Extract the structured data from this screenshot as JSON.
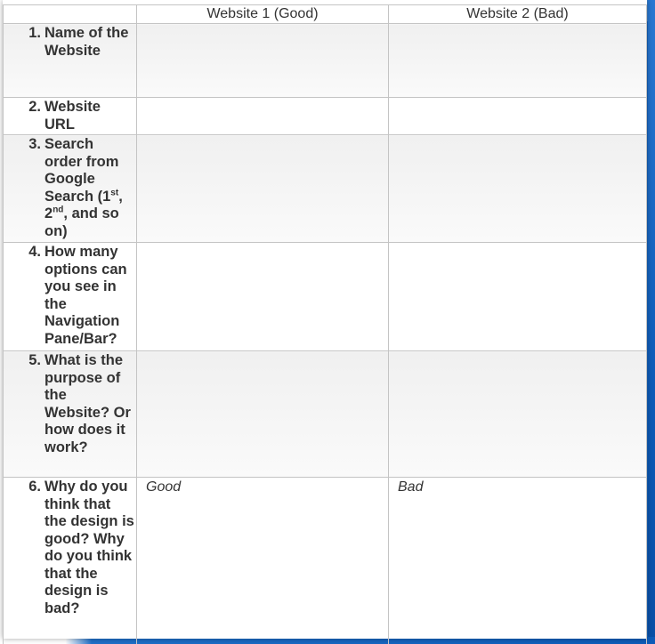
{
  "table": {
    "header": {
      "col1": "",
      "col2": "Website 1 (Good)",
      "col3": "Website 2 (Bad)"
    },
    "rows": [
      {
        "num": "1.",
        "question": "Name of the Website",
        "good": "",
        "bad": ""
      },
      {
        "num": "2.",
        "question": "Website URL",
        "good": "",
        "bad": ""
      },
      {
        "num": "3.",
        "question": "Search order from Google Search (1st, 2nd, and so on)",
        "q_parts": [
          "Search order from Google Search (1",
          "st",
          ", 2",
          "nd",
          ", and so on)"
        ],
        "good": "",
        "bad": ""
      },
      {
        "num": "4.",
        "question": "How many options can you see in the Navigation Pane/Bar?",
        "good": "",
        "bad": ""
      },
      {
        "num": "5.",
        "question": "What is the purpose of the Website? Or how does it work?",
        "good": "",
        "bad": ""
      },
      {
        "num": "6.",
        "question": "Why do you think that the design is good? Why do you think that the design is bad?",
        "good": "Good",
        "bad": "Bad"
      }
    ]
  },
  "colors": {
    "background_blue": "#1565c0",
    "border_gray": "#c4c4c4",
    "shaded_row": "#f0f0f0"
  }
}
